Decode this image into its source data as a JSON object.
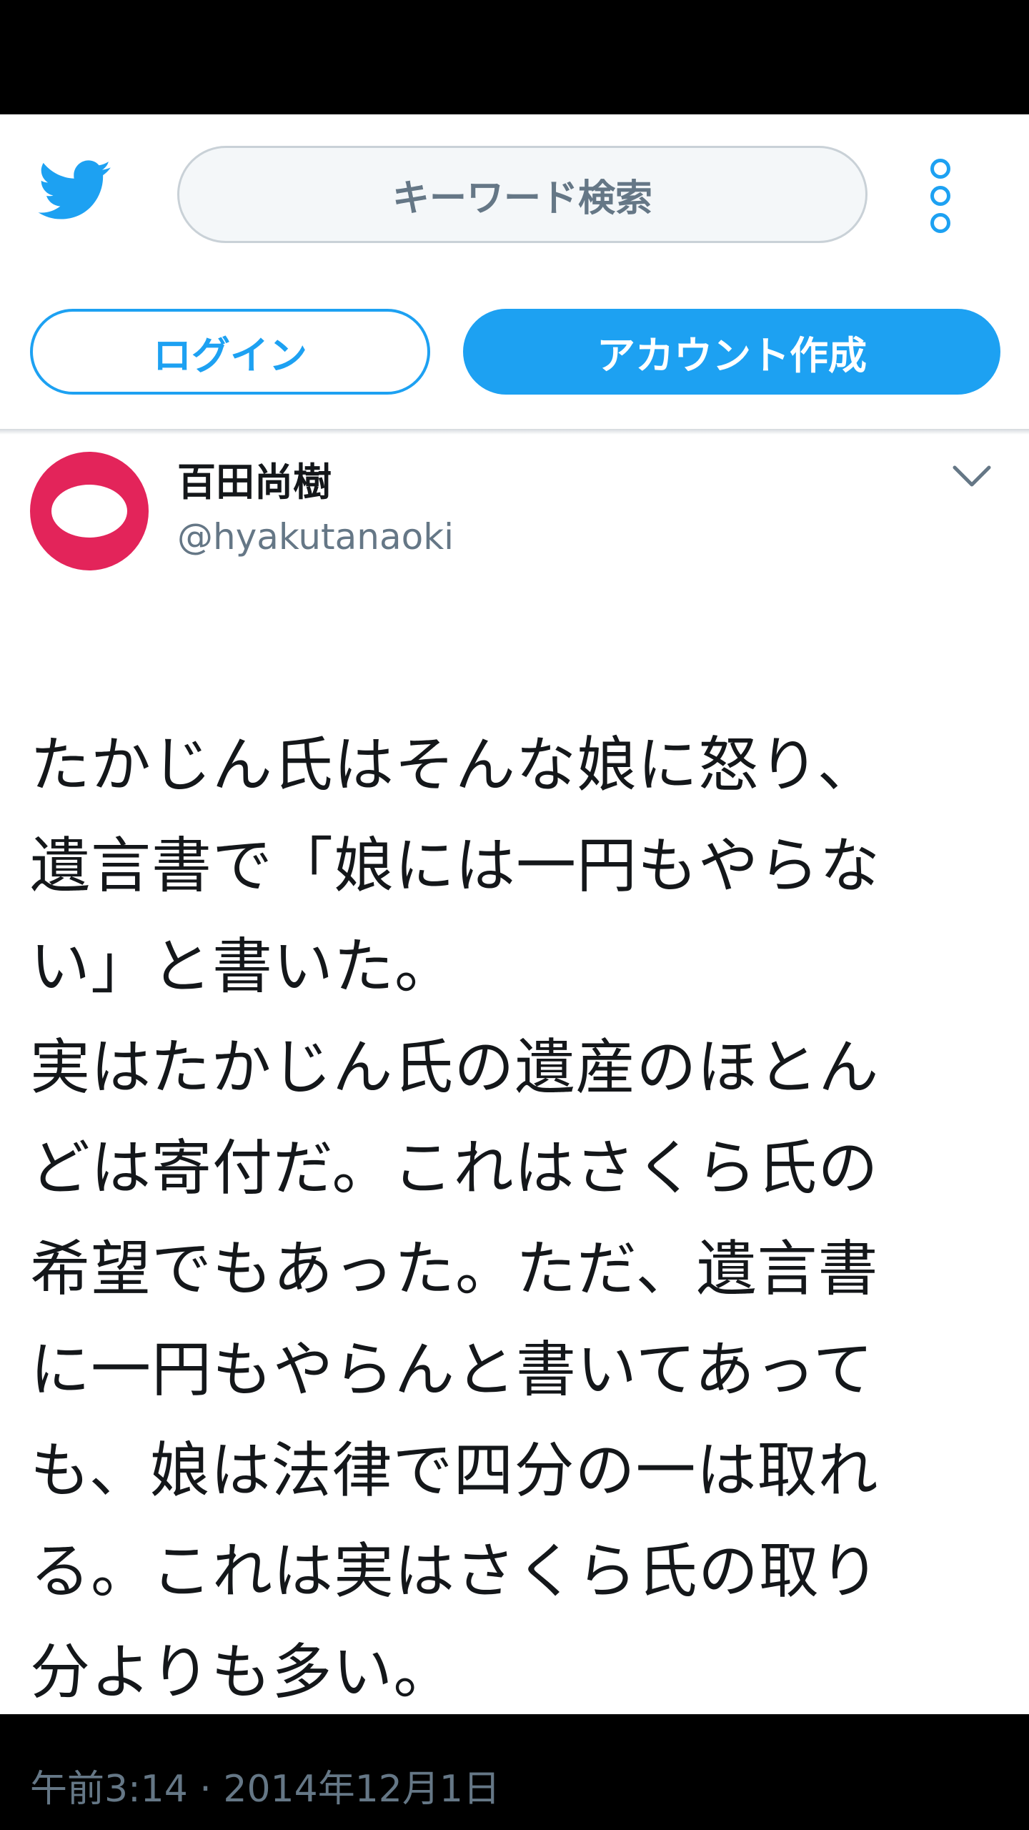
{
  "header": {
    "search_label": "キーワード検索",
    "login_label": "ログイン",
    "signup_label": "アカウント作成",
    "bird_icon": "twitter-bird-icon",
    "menu_icon": "more-vertical-icon",
    "accent_color": "#1da1f2"
  },
  "tweet": {
    "author_name": "百田尚樹",
    "author_handle": "@hyakutanaoki",
    "avatar_color": "#e3245a",
    "text_lines": [
      "たかじん氏はそんな娘に怒り、",
      "遺言書で「娘には一円もやらな",
      "い」と書いた。",
      "実はたかじん氏の遺産のほとん",
      "どは寄付だ。これはさくら氏の",
      "希望でもあった。ただ、遺言書",
      "に一円もやらんと書いてあって",
      "も、娘は法律で四分の一は取れ",
      "る。これは実はさくら氏の取り",
      "分よりも多い。"
    ],
    "timestamp": "午前3:14 · 2014年12月1日"
  }
}
